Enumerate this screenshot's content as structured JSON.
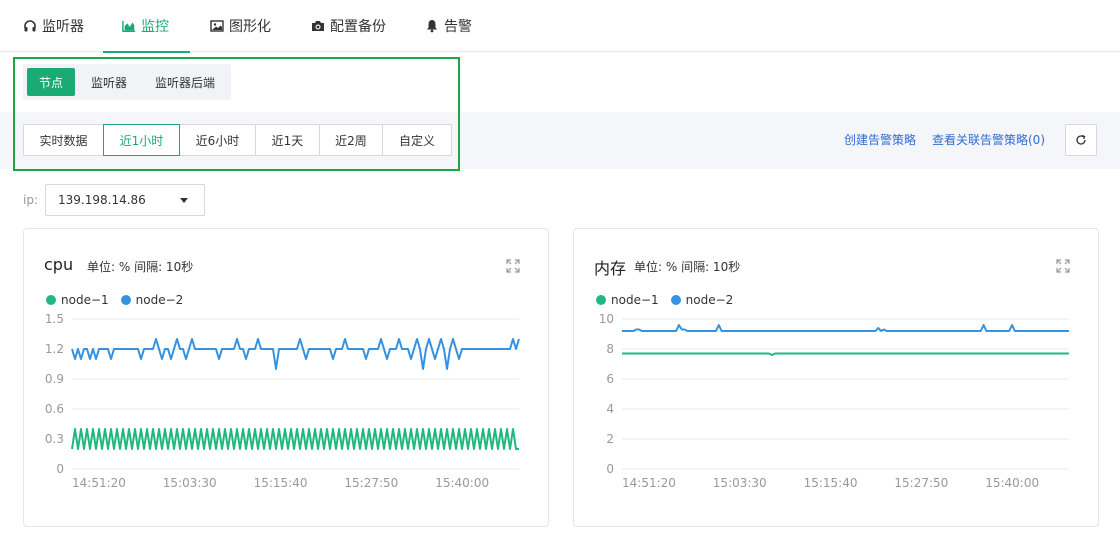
{
  "top_tabs": [
    {
      "label": "监听器",
      "icon": "headset-icon",
      "active": false
    },
    {
      "label": "监控",
      "icon": "area-chart-icon",
      "active": true
    },
    {
      "label": "图形化",
      "icon": "image-icon",
      "active": false
    },
    {
      "label": "配置备份",
      "icon": "camera-icon",
      "active": false
    },
    {
      "label": "告警",
      "icon": "bell-icon",
      "active": false
    }
  ],
  "sub_tabs": [
    {
      "label": "节点",
      "active": true
    },
    {
      "label": "监听器",
      "active": false
    },
    {
      "label": "监听器后端",
      "active": false
    }
  ],
  "time_ranges": [
    {
      "label": "实时数据",
      "active": false
    },
    {
      "label": "近1小时",
      "active": true
    },
    {
      "label": "近6小时",
      "active": false
    },
    {
      "label": "近1天",
      "active": false
    },
    {
      "label": "近2周",
      "active": false
    },
    {
      "label": "自定义",
      "active": false
    }
  ],
  "actions": {
    "create_alarm": "创建告警策略",
    "view_alarm": "查看关联告警策略(0)",
    "refresh_icon": "refresh-icon"
  },
  "ip": {
    "label": "ip:",
    "value": "139.198.14.86"
  },
  "colors": {
    "accent": "#1aab74",
    "node1": "#20b882",
    "node2": "#3492e0",
    "link": "#2f6cd4"
  },
  "charts": [
    {
      "title": "cpu",
      "unit_text": "单位: % 间隔: 10秒",
      "expand_icon": "expand-icon"
    },
    {
      "title": "内存",
      "unit_text": "单位: % 间隔: 10秒",
      "expand_icon": "expand-icon"
    }
  ],
  "chart_data": [
    {
      "type": "line",
      "title": "cpu",
      "unit": "%",
      "interval": "10秒",
      "ylim": [
        0,
        1.5
      ],
      "yticks": [
        "0",
        "0.3",
        "0.6",
        "0.9",
        "1.2",
        "1.5"
      ],
      "xticks": [
        "14:51:20",
        "15:03:30",
        "15:15:40",
        "15:27:50",
        "15:40:00"
      ],
      "grid": true,
      "legend": "top-left",
      "series": [
        {
          "name": "node−1",
          "color": "#20b882",
          "values": [
            0.2,
            0.4,
            0.2,
            0.4,
            0.2,
            0.4,
            0.2,
            0.4,
            0.2,
            0.4,
            0.2,
            0.4,
            0.2,
            0.4,
            0.2,
            0.4,
            0.2,
            0.4,
            0.2,
            0.4,
            0.2,
            0.4,
            0.2,
            0.4,
            0.2,
            0.4,
            0.2,
            0.4,
            0.2,
            0.4,
            0.2,
            0.4,
            0.2,
            0.4,
            0.2,
            0.4,
            0.2,
            0.4,
            0.2,
            0.4,
            0.2,
            0.4,
            0.2,
            0.4,
            0.2,
            0.4,
            0.2,
            0.4,
            0.2,
            0.4,
            0.2,
            0.4,
            0.2,
            0.4,
            0.2,
            0.4,
            0.2,
            0.4,
            0.2,
            0.4,
            0.2,
            0.4,
            0.2,
            0.4,
            0.2,
            0.4,
            0.2,
            0.4,
            0.2,
            0.4,
            0.2,
            0.4,
            0.2,
            0.4,
            0.2,
            0.4,
            0.2,
            0.4,
            0.2,
            0.4,
            0.2,
            0.4,
            0.2,
            0.4,
            0.2,
            0.4,
            0.2,
            0.4,
            0.2,
            0.4,
            0.2,
            0.4,
            0.2,
            0.4,
            0.2,
            0.4,
            0.2,
            0.4,
            0.2,
            0.4,
            0.2,
            0.4,
            0.2,
            0.4,
            0.2,
            0.4,
            0.2,
            0.4,
            0.2,
            0.4,
            0.2,
            0.4,
            0.2,
            0.4,
            0.2,
            0.4,
            0.2,
            0.4,
            0.2,
            0.4,
            0.2,
            0.4,
            0.2,
            0.4,
            0.2,
            0.4,
            0.2,
            0.4,
            0.2,
            0.4,
            0.2,
            0.4,
            0.2,
            0.4,
            0.2,
            0.4,
            0.2,
            0.4,
            0.2,
            0.4,
            0.2,
            0.4,
            0.2,
            0.4,
            0.2,
            0.4,
            0.2,
            0.4,
            0.2,
            0.2
          ]
        },
        {
          "name": "node−2",
          "color": "#3492e0",
          "values": [
            1.2,
            1.1,
            1.2,
            1.1,
            1.2,
            1.2,
            1.1,
            1.2,
            1.1,
            1.2,
            1.2,
            1.2,
            1.2,
            1.1,
            1.2,
            1.2,
            1.2,
            1.2,
            1.2,
            1.2,
            1.2,
            1.2,
            1.2,
            1.1,
            1.2,
            1.2,
            1.2,
            1.2,
            1.3,
            1.2,
            1.1,
            1.2,
            1.2,
            1.1,
            1.2,
            1.3,
            1.2,
            1.2,
            1.1,
            1.2,
            1.3,
            1.2,
            1.2,
            1.2,
            1.2,
            1.2,
            1.2,
            1.2,
            1.2,
            1.1,
            1.2,
            1.2,
            1.2,
            1.2,
            1.2,
            1.3,
            1.2,
            1.2,
            1.1,
            1.2,
            1.2,
            1.2,
            1.3,
            1.2,
            1.2,
            1.2,
            1.2,
            1.2,
            1.0,
            1.2,
            1.2,
            1.2,
            1.2,
            1.2,
            1.2,
            1.2,
            1.3,
            1.2,
            1.1,
            1.2,
            1.2,
            1.2,
            1.2,
            1.2,
            1.2,
            1.2,
            1.2,
            1.1,
            1.2,
            1.2,
            1.2,
            1.3,
            1.2,
            1.2,
            1.2,
            1.2,
            1.2,
            1.2,
            1.1,
            1.2,
            1.2,
            1.2,
            1.2,
            1.3,
            1.2,
            1.1,
            1.2,
            1.2,
            1.2,
            1.3,
            1.2,
            1.2,
            1.2,
            1.1,
            1.2,
            1.3,
            1.2,
            1.0,
            1.2,
            1.3,
            1.2,
            1.1,
            1.2,
            1.3,
            1.2,
            1.0,
            1.2,
            1.3,
            1.2,
            1.1,
            1.2,
            1.2,
            1.2,
            1.2,
            1.2,
            1.2,
            1.2,
            1.2,
            1.2,
            1.2,
            1.2,
            1.2,
            1.2,
            1.2,
            1.2,
            1.2,
            1.2,
            1.3,
            1.2,
            1.3
          ]
        }
      ]
    },
    {
      "type": "line",
      "title": "内存",
      "unit": "%",
      "interval": "10秒",
      "ylim": [
        0,
        10
      ],
      "yticks": [
        "0",
        "2",
        "4",
        "6",
        "8",
        "10"
      ],
      "xticks": [
        "14:51:20",
        "15:03:30",
        "15:15:40",
        "15:27:50",
        "15:40:00"
      ],
      "grid": true,
      "legend": "top-left",
      "series": [
        {
          "name": "node−1",
          "color": "#20b882",
          "values": [
            7.7,
            7.7,
            7.7,
            7.7,
            7.7,
            7.7,
            7.7,
            7.7,
            7.7,
            7.7,
            7.7,
            7.7,
            7.7,
            7.7,
            7.7,
            7.7,
            7.7,
            7.7,
            7.7,
            7.7,
            7.7,
            7.7,
            7.7,
            7.7,
            7.7,
            7.7,
            7.7,
            7.7,
            7.7,
            7.7,
            7.7,
            7.7,
            7.7,
            7.7,
            7.7,
            7.7,
            7.7,
            7.7,
            7.7,
            7.7,
            7.7,
            7.7,
            7.7,
            7.7,
            7.7,
            7.7,
            7.7,
            7.7,
            7.7,
            7.7,
            7.6,
            7.7,
            7.7,
            7.7,
            7.7,
            7.7,
            7.7,
            7.7,
            7.7,
            7.7,
            7.7,
            7.7,
            7.7,
            7.7,
            7.7,
            7.7,
            7.7,
            7.7,
            7.7,
            7.7,
            7.7,
            7.7,
            7.7,
            7.7,
            7.7,
            7.7,
            7.7,
            7.7,
            7.7,
            7.7,
            7.7,
            7.7,
            7.7,
            7.7,
            7.7,
            7.7,
            7.7,
            7.7,
            7.7,
            7.7,
            7.7,
            7.7,
            7.7,
            7.7,
            7.7,
            7.7,
            7.7,
            7.7,
            7.7,
            7.7,
            7.7,
            7.7,
            7.7,
            7.7,
            7.7,
            7.7,
            7.7,
            7.7,
            7.7,
            7.7,
            7.7,
            7.7,
            7.7,
            7.7,
            7.7,
            7.7,
            7.7,
            7.7,
            7.7,
            7.7,
            7.7,
            7.7,
            7.7,
            7.7,
            7.7,
            7.7,
            7.7,
            7.7,
            7.7,
            7.7,
            7.7,
            7.7,
            7.7,
            7.7,
            7.7,
            7.7,
            7.7,
            7.7,
            7.7,
            7.7,
            7.7,
            7.7,
            7.7,
            7.7,
            7.7,
            7.7,
            7.7,
            7.7,
            7.7,
            7.7
          ]
        },
        {
          "name": "node−2",
          "color": "#3492e0",
          "values": [
            9.2,
            9.2,
            9.2,
            9.2,
            9.2,
            9.3,
            9.3,
            9.2,
            9.2,
            9.2,
            9.2,
            9.2,
            9.2,
            9.2,
            9.2,
            9.2,
            9.2,
            9.2,
            9.2,
            9.2,
            9.6,
            9.3,
            9.3,
            9.2,
            9.2,
            9.2,
            9.2,
            9.2,
            9.2,
            9.2,
            9.2,
            9.2,
            9.2,
            9.2,
            9.6,
            9.2,
            9.2,
            9.2,
            9.2,
            9.2,
            9.2,
            9.2,
            9.2,
            9.2,
            9.2,
            9.2,
            9.2,
            9.2,
            9.2,
            9.2,
            9.2,
            9.2,
            9.2,
            9.2,
            9.2,
            9.2,
            9.2,
            9.2,
            9.2,
            9.2,
            9.2,
            9.2,
            9.2,
            9.2,
            9.2,
            9.2,
            9.2,
            9.2,
            9.2,
            9.2,
            9.2,
            9.2,
            9.2,
            9.2,
            9.2,
            9.2,
            9.2,
            9.2,
            9.2,
            9.2,
            9.2,
            9.2,
            9.2,
            9.2,
            9.2,
            9.2,
            9.2,
            9.2,
            9.2,
            9.2,
            9.4,
            9.2,
            9.3,
            9.2,
            9.2,
            9.2,
            9.2,
            9.2,
            9.2,
            9.2,
            9.2,
            9.2,
            9.2,
            9.2,
            9.2,
            9.2,
            9.2,
            9.2,
            9.2,
            9.2,
            9.2,
            9.2,
            9.2,
            9.2,
            9.2,
            9.2,
            9.2,
            9.2,
            9.2,
            9.2,
            9.2,
            9.2,
            9.2,
            9.2,
            9.2,
            9.2,
            9.2,
            9.6,
            9.2,
            9.2,
            9.2,
            9.2,
            9.2,
            9.2,
            9.2,
            9.2,
            9.2,
            9.6,
            9.2,
            9.2,
            9.2,
            9.2,
            9.2,
            9.2,
            9.2,
            9.2,
            9.2,
            9.2,
            9.2,
            9.2,
            9.2,
            9.2,
            9.2,
            9.2,
            9.2,
            9.2,
            9.2,
            9.2
          ]
        }
      ]
    }
  ]
}
